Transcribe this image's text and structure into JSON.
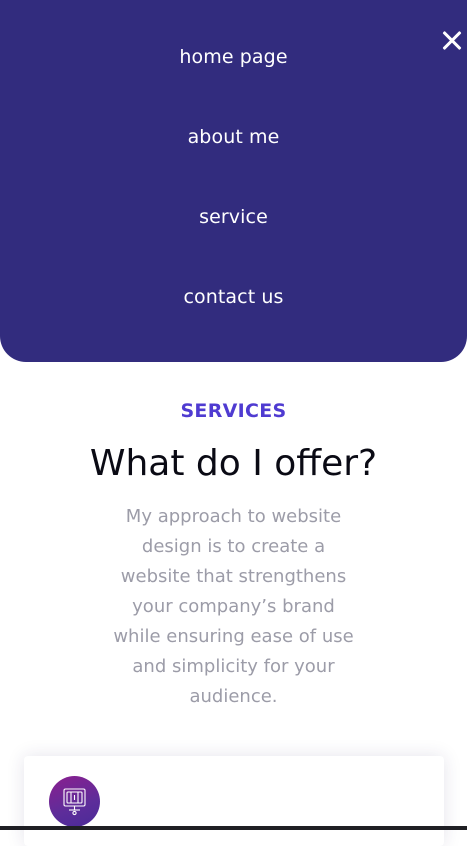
{
  "nav": {
    "items": [
      {
        "label": "home page"
      },
      {
        "label": "about me"
      },
      {
        "label": "service"
      },
      {
        "label": "contact us"
      }
    ],
    "close_icon": "close-icon"
  },
  "services": {
    "eyebrow": "SERVICES",
    "heading": "What do I offer?",
    "description": "My approach to website design is to create a website that strengthens your company’s brand while ensuring ease of use and simplicity for your audience."
  },
  "service_card": {
    "icon": "web-design-icon"
  },
  "colors": {
    "nav_background": "#322c7e",
    "accent": "#4f3bd1",
    "body_text": "#9c9ca8",
    "icon_gradient_start": "#8b1f8f",
    "icon_gradient_end": "#4a2a98"
  }
}
